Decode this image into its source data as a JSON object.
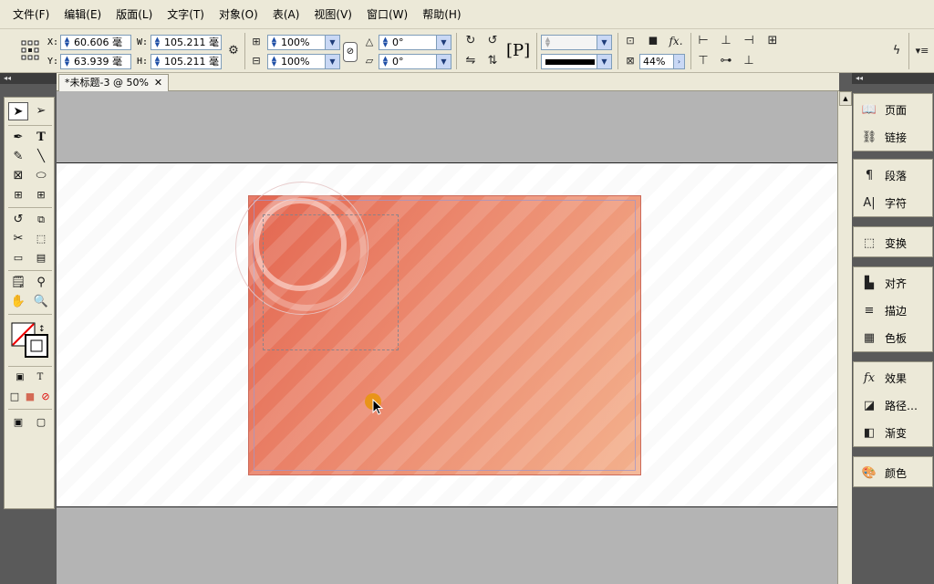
{
  "menu": [
    "文件(F)",
    "编辑(E)",
    "版面(L)",
    "文字(T)",
    "对象(O)",
    "表(A)",
    "视图(V)",
    "窗口(W)",
    "帮助(H)"
  ],
  "control": {
    "x_label": "X:",
    "x_value": "60.606 毫",
    "y_label": "Y:",
    "y_value": "63.939 毫",
    "w_label": "W:",
    "w_value": "105.211 毫",
    "h_label": "H:",
    "h_value": "105.211 毫",
    "scale_x": "100%",
    "scale_y": "100%",
    "rotate": "0°",
    "shear": "0°",
    "stroke_weight": "",
    "opacity": "44%"
  },
  "tab": {
    "title": "*未标题-3 @ 50%",
    "close": "✕"
  },
  "right_panel": {
    "group1": [
      {
        "icon": "pages-icon",
        "label": "页面"
      },
      {
        "icon": "links-icon",
        "label": "链接"
      }
    ],
    "group2": [
      {
        "icon": "paragraph-icon",
        "label": "段落"
      },
      {
        "icon": "character-icon",
        "label": "字符"
      }
    ],
    "group3": [
      {
        "icon": "transform-icon",
        "label": "变换"
      }
    ],
    "group4": [
      {
        "icon": "align-icon",
        "label": "对齐"
      },
      {
        "icon": "stroke-icon",
        "label": "描边"
      },
      {
        "icon": "swatches-icon",
        "label": "色板"
      }
    ],
    "group5": [
      {
        "icon": "effects-icon",
        "label": "效果"
      },
      {
        "icon": "pathfinder-icon",
        "label": "路径…"
      },
      {
        "icon": "gradient-icon",
        "label": "渐变"
      }
    ],
    "group6": [
      {
        "icon": "color-icon",
        "label": "颜色"
      }
    ]
  },
  "colors": {
    "art_start": "#e36650",
    "art_end": "#f3b08c",
    "cursor": "#e8930c",
    "ui": "#ece9d8"
  }
}
